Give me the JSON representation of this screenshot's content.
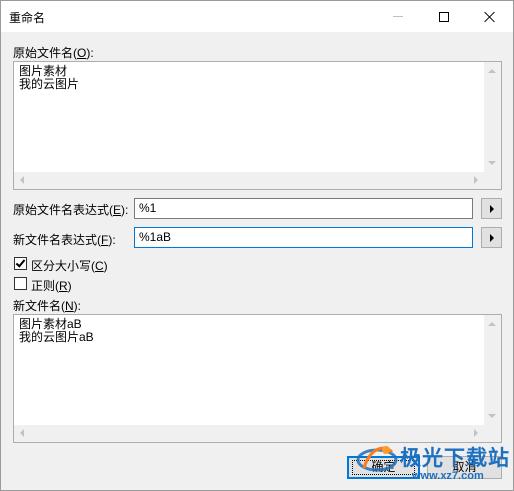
{
  "window": {
    "title": "重命名"
  },
  "original": {
    "label": "原始文件名(",
    "label_key": "O",
    "label_end": "):",
    "names": [
      "图片素材",
      "我的云图片"
    ]
  },
  "orig_expr": {
    "label": "原始文件名表达式(",
    "label_key": "E",
    "label_end": "):",
    "value": "%1"
  },
  "new_expr": {
    "label": "新文件名表达式(",
    "label_key": "F",
    "label_end": "):",
    "value": "%1aB"
  },
  "options": {
    "case_sensitive": {
      "label": "区分大小写(",
      "key": "C",
      "end": ")",
      "checked": true
    },
    "regex": {
      "label": "正则(",
      "key": "R",
      "end": ")",
      "checked": false
    }
  },
  "result": {
    "label": "新文件名(",
    "label_key": "N",
    "label_end": "):",
    "names": [
      "图片素材aB",
      "我的云图片aB"
    ]
  },
  "buttons": {
    "ok": "确定",
    "cancel": "取消"
  },
  "watermark": {
    "title": "极光下载站",
    "url": "www.xz7.com"
  },
  "colors": {
    "accent": "#0078d7",
    "watermark": "#1d6fc0"
  }
}
